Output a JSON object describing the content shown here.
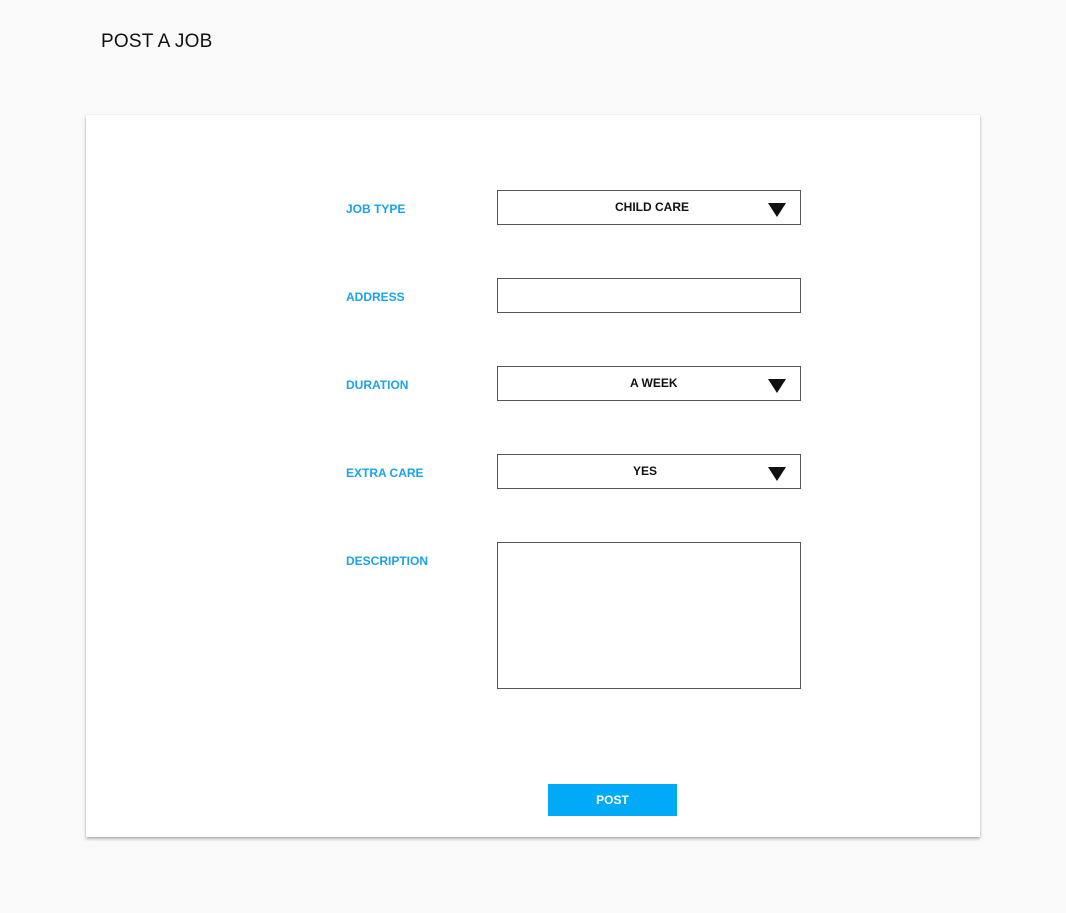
{
  "page": {
    "title": "POST A JOB"
  },
  "form": {
    "job_type": {
      "label": "JOB TYPE",
      "value": "CHILD CARE",
      "icon": "caret-down-icon"
    },
    "address": {
      "label": "ADDRESS",
      "value": "",
      "placeholder": ""
    },
    "duration": {
      "label": "DURATION",
      "value": "A WEEK",
      "icon": "caret-down-icon"
    },
    "extra_care": {
      "label": "EXTRA CARE",
      "value": "YES",
      "icon": "caret-down-icon"
    },
    "description": {
      "label": "DESCRIPTION",
      "value": "",
      "placeholder": ""
    },
    "post_button_label": "POST"
  },
  "colors": {
    "accent": "#00aaf7",
    "label": "#1aa3e8",
    "background": "#f9f9f9",
    "card": "#ffffff"
  }
}
